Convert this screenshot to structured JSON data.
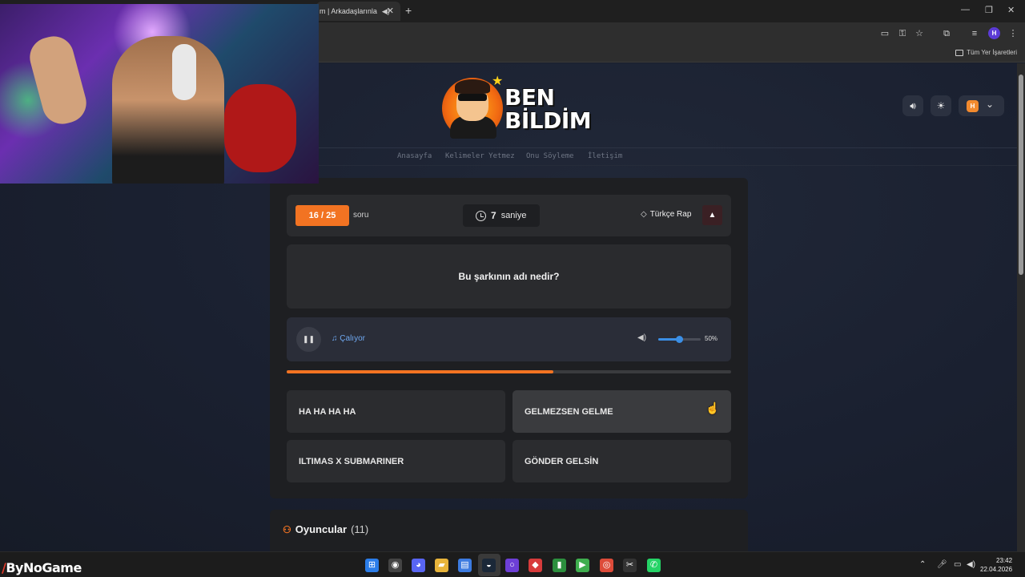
{
  "browser": {
    "tab_title": "m | Arkadaşlarınla",
    "tab_speaker_icon": "speaker-icon",
    "bookmarks_all": "Tüm Yer İşaretleri"
  },
  "header": {
    "logo_line1": "BEN",
    "logo_line2": "BİLDİM",
    "user_initial": "H",
    "nav": [
      "Anasayfa",
      "Kelimeler Yetmez",
      "Onu Söyleme",
      "İletişim"
    ]
  },
  "quiz": {
    "counter": "16 / 25",
    "counter_suffix": "soru",
    "timer_value": "7",
    "timer_unit": "saniye",
    "category": "Türkçe Rap",
    "question": "Bu şarkının adı nedir?",
    "player_status": "Çalıyor",
    "volume_label": "50%",
    "volume_fraction": 0.5,
    "progress_fraction": 0.6,
    "answers": [
      "HA HA HA HA",
      "GELMEZSEN GELME",
      "ILTIMAS X SUBMARINER",
      "GÖNDER GELSİN"
    ]
  },
  "players": {
    "title": "Oyuncular",
    "count": "(11)"
  },
  "taskbar": {
    "brand": "ByNoGame",
    "time": "23:42",
    "date": "22.04.2026"
  },
  "colors": {
    "accent": "#f27322",
    "link_blue": "#6fa8f0",
    "volume_blue": "#3b8fe6"
  }
}
